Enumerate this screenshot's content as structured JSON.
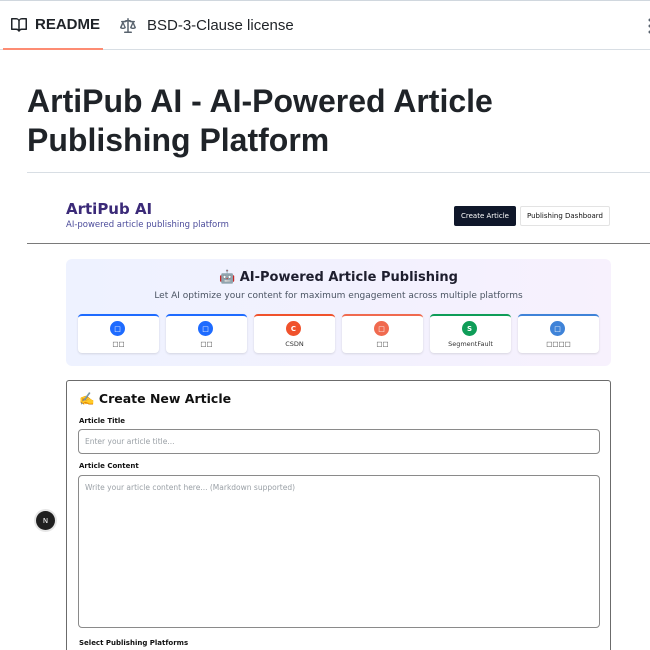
{
  "tabs": {
    "readme": {
      "label": "README",
      "icon": "book-icon"
    },
    "license": {
      "label": "BSD-3-Clause license",
      "icon": "scale-icon"
    },
    "more_icon": "kebab-icon"
  },
  "readme": {
    "title": "ArtiPub AI - AI-Powered Article Publishing Platform"
  },
  "app": {
    "brand": "ArtiPub AI",
    "tagline": "AI-powered article publishing platform",
    "nav": {
      "create_label": "Create Article",
      "dashboard_label": "Publishing Dashboard"
    },
    "hero": {
      "title": "🤖 AI-Powered Article Publishing",
      "subtitle": "Let AI optimize your content for maximum engagement across multiple platforms"
    },
    "platforms": [
      {
        "name": "□□",
        "badge": "□",
        "color": "#1e6bff"
      },
      {
        "name": "□□",
        "badge": "□",
        "color": "#1e6bff"
      },
      {
        "name": "CSDN",
        "badge": "C",
        "color": "#f0522c"
      },
      {
        "name": "□□",
        "badge": "□",
        "color": "#f06a4f"
      },
      {
        "name": "SegmentFault",
        "badge": "S",
        "color": "#0f9d58"
      },
      {
        "name": "□□□□",
        "badge": "□",
        "color": "#3f83d8"
      }
    ],
    "form": {
      "title": "✍️ Create New Article",
      "title_label": "Article Title",
      "title_placeholder": "Enter your article title...",
      "content_label": "Article Content",
      "content_placeholder": "Write your article content here... (Markdown supported)",
      "platforms_label": "Select Publishing Platforms"
    },
    "floating_badge": "N"
  },
  "colors": {
    "tab_underline": "#fd8c73",
    "brand": "#3b2a78",
    "primary_button": "#0f172a"
  }
}
